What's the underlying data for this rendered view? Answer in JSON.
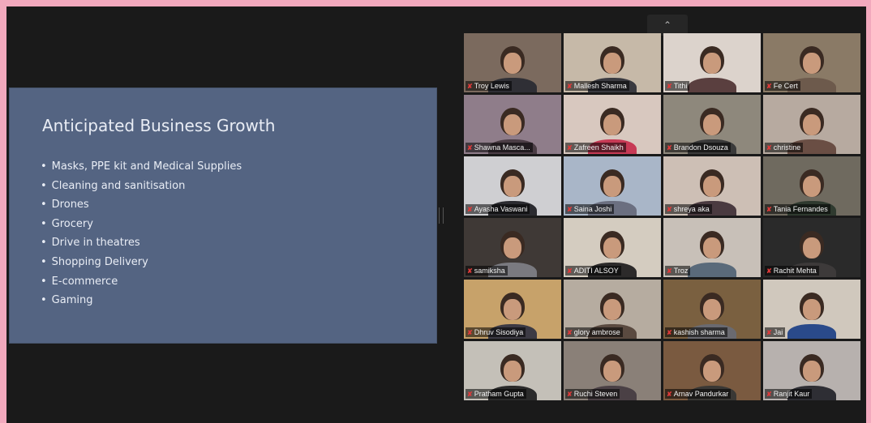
{
  "slide": {
    "title": "Anticipated Business Growth",
    "bullets": [
      "Masks, PPE kit and Medical Supplies",
      "Cleaning and sanitisation",
      "Drones",
      "Grocery",
      "Drive in theatres",
      "Shopping Delivery",
      "E-commerce",
      "Gaming"
    ]
  },
  "toolbar": {
    "collapse_icon": "chevron-up-icon",
    "collapse_glyph": "⌃"
  },
  "participants": [
    {
      "name": "Troy Lewis",
      "bg": "#7b6a5e",
      "shirt": "#2f2f35"
    },
    {
      "name": "Mallesh Sharma",
      "bg": "#c6b9a8",
      "shirt": "#3a3a40"
    },
    {
      "name": "Tithi",
      "bg": "#dcd3cc",
      "shirt": "#5a3f3f"
    },
    {
      "name": "Fe Cert",
      "bg": "#8a7a66",
      "shirt": "#6d5a4c"
    },
    {
      "name": "Shawna Masca...",
      "bg": "#8f7d8a",
      "shirt": "#4b3d45"
    },
    {
      "name": "Zafreen Shaikh",
      "bg": "#d8c8bf",
      "shirt": "#c73a55"
    },
    {
      "name": "Brandon Dsouza",
      "bg": "#8e887c",
      "shirt": "#3a3a3a"
    },
    {
      "name": "christine",
      "bg": "#b7aaa0",
      "shirt": "#6a4e44"
    },
    {
      "name": "Ayasha Vaswani",
      "bg": "#cfcfd2",
      "shirt": "#2b2b30"
    },
    {
      "name": "Saina Joshi",
      "bg": "#a9b6c8",
      "shirt": "#6b6f80"
    },
    {
      "name": "shreya aka",
      "bg": "#cdbfb5",
      "shirt": "#4a3a40"
    },
    {
      "name": "Tania Fernandes",
      "bg": "#6f6a5f",
      "shirt": "#2f3a2f"
    },
    {
      "name": "samiksha",
      "bg": "#3f3936",
      "shirt": "#7a7a80"
    },
    {
      "name": "ADITI ALSOY",
      "bg": "#d4ccc0",
      "shirt": "#2c2a2a"
    },
    {
      "name": "Troz",
      "bg": "#c8c0b8",
      "shirt": "#5a6a7a"
    },
    {
      "name": "Rachit Mehta",
      "bg": "#2a2a2a",
      "shirt": "#3d3a3a"
    },
    {
      "name": "Dhruv Sisodiya",
      "bg": "#c7a26a",
      "shirt": "#3c3a44"
    },
    {
      "name": "glory ambrose",
      "bg": "#b6aca0",
      "shirt": "#5a4a40"
    },
    {
      "name": "kashish sharma",
      "bg": "#7a6040",
      "shirt": "#6a6a70"
    },
    {
      "name": "Jai",
      "bg": "#d0c8bd",
      "shirt": "#2a4a8a"
    },
    {
      "name": "Pratham Gupta",
      "bg": "#c4c0b8",
      "shirt": "#2b2b2b"
    },
    {
      "name": "Ruchi Steven",
      "bg": "#8a8078",
      "shirt": "#4a4045"
    },
    {
      "name": "Arnav Pandurkar",
      "bg": "#7a5a40",
      "shirt": "#3a3835"
    },
    {
      "name": "Ranjit Kaur",
      "bg": "#b7b1ae",
      "shirt": "#2e2e34"
    }
  ]
}
